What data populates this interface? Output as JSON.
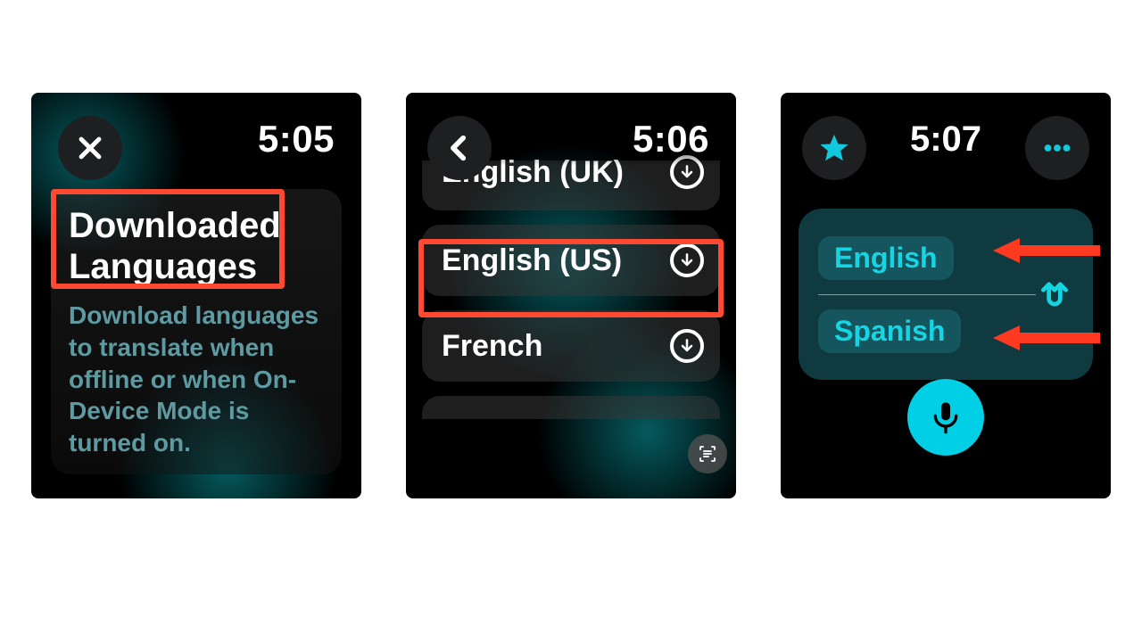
{
  "colors": {
    "highlight": "#ff4930",
    "accent": "#00cfe5",
    "accent_text": "#15d5e3",
    "panel": "#0e3a40"
  },
  "screens": [
    {
      "id": "s1",
      "time": "5:05",
      "close_label": "close",
      "panel": {
        "title": "Downloaded Languages",
        "description": "Download languages to translate when offline or when On-Device Mode is turned on."
      },
      "highlight_around": "title"
    },
    {
      "id": "s2",
      "time": "5:06",
      "back_label": "back",
      "languages": [
        {
          "label": "English (UK)",
          "download": true
        },
        {
          "label": "English (US)",
          "download": true,
          "highlighted": true
        },
        {
          "label": "French",
          "download": true
        }
      ],
      "overlay_icon": "scan-text-icon"
    },
    {
      "id": "s3",
      "time": "5:07",
      "star_label": "favorites",
      "more_label": "more",
      "pair": {
        "source": "English",
        "target": "Spanish",
        "swap_icon": "swap-icon"
      },
      "mic_label": "microphone",
      "arrows": [
        "source",
        "target"
      ]
    }
  ]
}
